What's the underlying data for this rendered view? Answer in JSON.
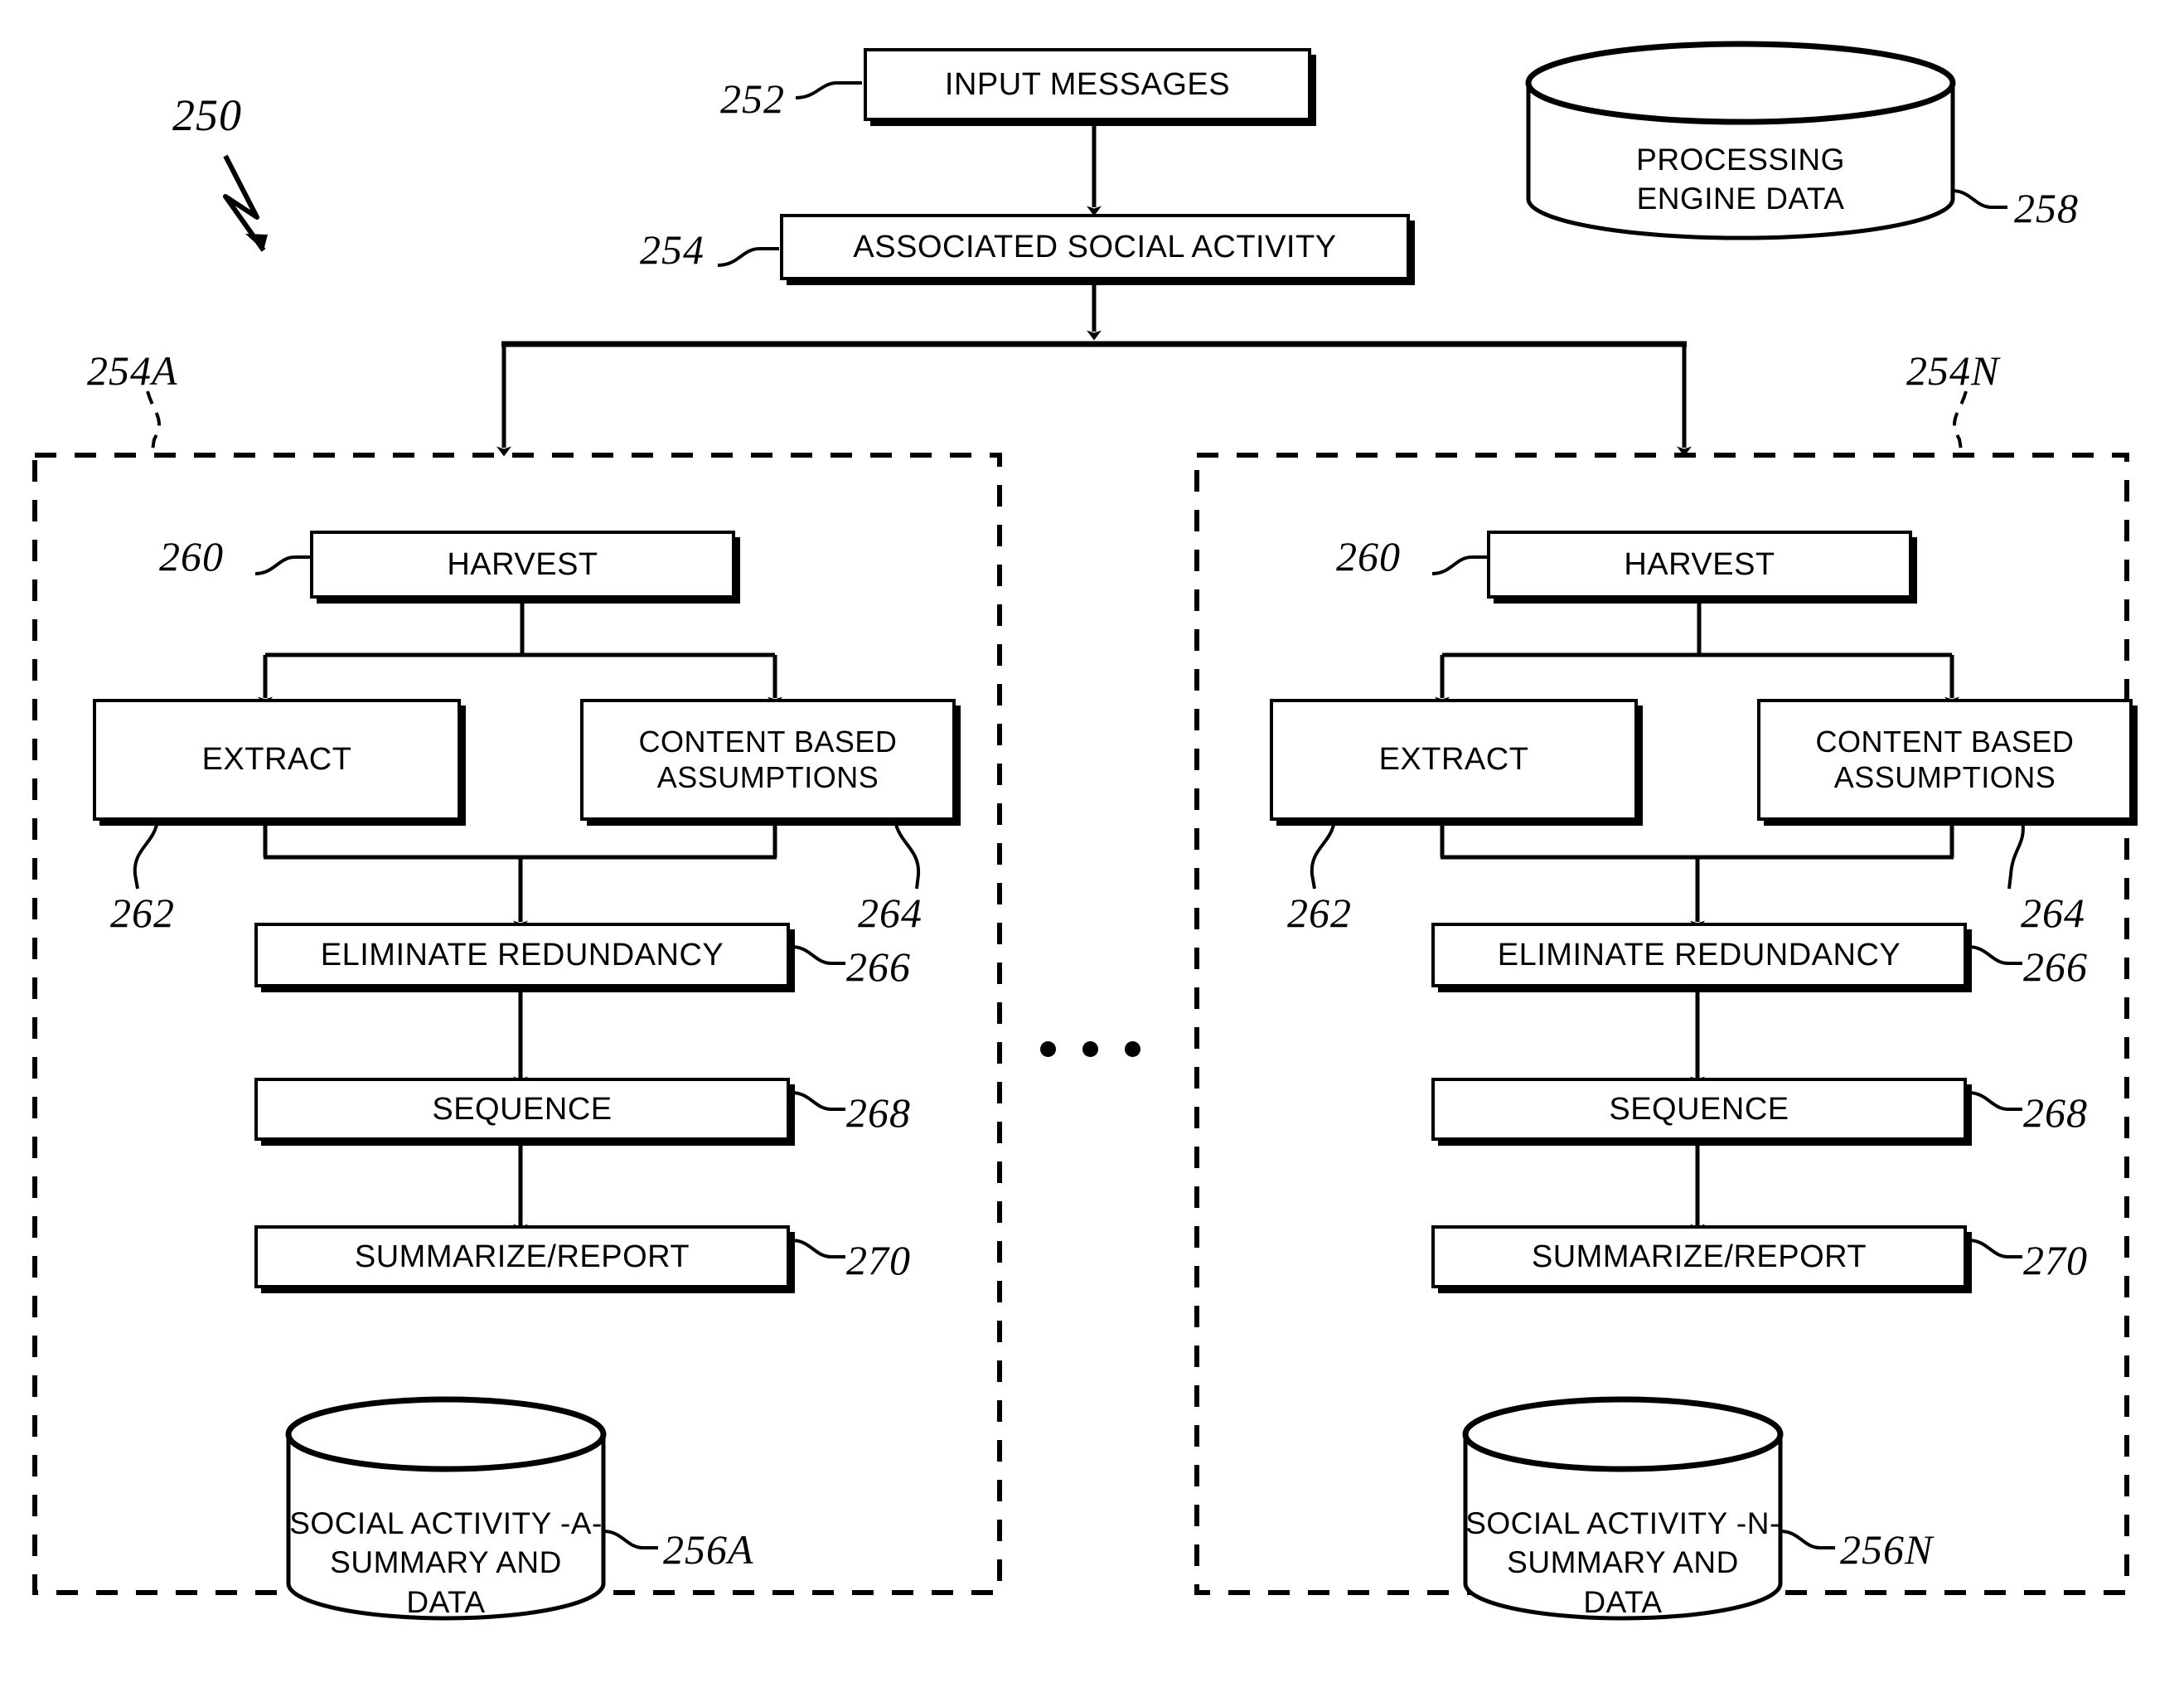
{
  "figure": {
    "number": "250",
    "ellipsis": "• • •"
  },
  "top_flow": {
    "input_messages": {
      "label": "INPUT MESSAGES",
      "ref": "252"
    },
    "associated_social_activity": {
      "label": "ASSOCIATED SOCIAL ACTIVITY",
      "ref": "254"
    },
    "processing_engine_data": {
      "label_line1": "PROCESSING",
      "label_line2": "ENGINE DATA",
      "ref": "258"
    }
  },
  "panels": [
    {
      "ref": "254A",
      "harvest": {
        "label": "HARVEST",
        "ref": "260"
      },
      "extract": {
        "label": "EXTRACT",
        "ref": "262"
      },
      "assumptions": {
        "label_line1": "CONTENT BASED",
        "label_line2": "ASSUMPTIONS",
        "ref": "264"
      },
      "eliminate": {
        "label": "ELIMINATE REDUNDANCY",
        "ref": "266"
      },
      "sequence": {
        "label": "SEQUENCE",
        "ref": "268"
      },
      "summarize": {
        "label": "SUMMARIZE/REPORT",
        "ref": "270"
      },
      "store": {
        "label_line1": "SOCIAL ACTIVITY -A-",
        "label_line2": "SUMMARY AND DATA",
        "ref": "256A"
      }
    },
    {
      "ref": "254N",
      "harvest": {
        "label": "HARVEST",
        "ref": "260"
      },
      "extract": {
        "label": "EXTRACT",
        "ref": "262"
      },
      "assumptions": {
        "label_line1": "CONTENT BASED",
        "label_line2": "ASSUMPTIONS",
        "ref": "264"
      },
      "eliminate": {
        "label": "ELIMINATE REDUNDANCY",
        "ref": "266"
      },
      "sequence": {
        "label": "SEQUENCE",
        "ref": "268"
      },
      "summarize": {
        "label": "SUMMARIZE/REPORT",
        "ref": "270"
      },
      "store": {
        "label_line1": "SOCIAL ACTIVITY -N-",
        "label_line2": "SUMMARY AND DATA",
        "ref": "256N"
      }
    }
  ],
  "colors": {
    "ink": "#000000",
    "paper": "#ffffff"
  }
}
